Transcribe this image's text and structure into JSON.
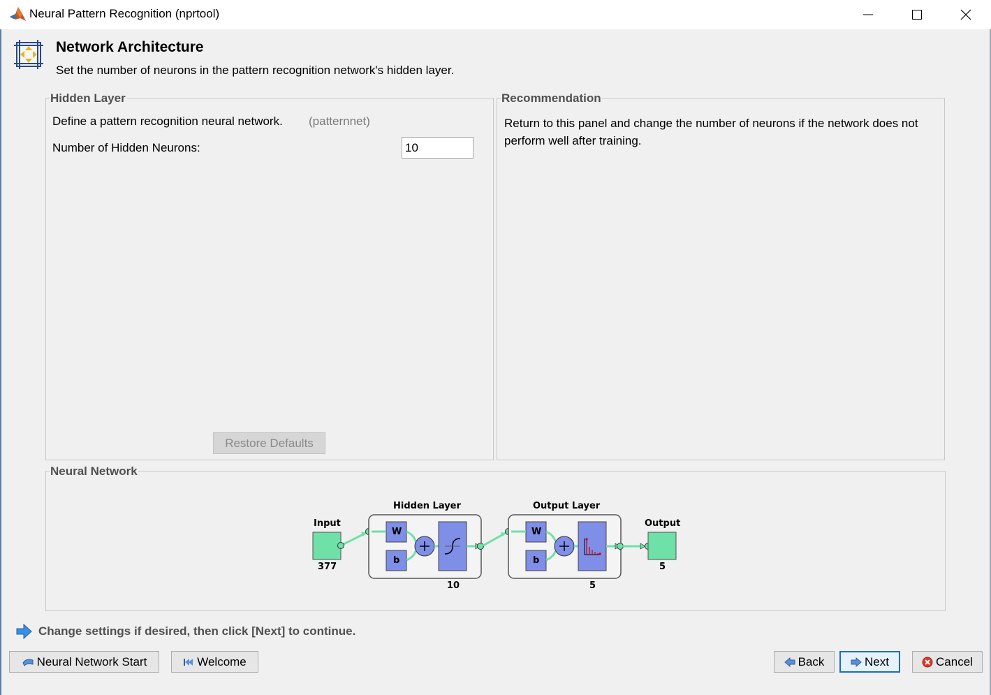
{
  "window": {
    "title": "Neural Pattern Recognition (nprtool)"
  },
  "header": {
    "title": "Network Architecture",
    "subtitle": "Set the number of neurons in the pattern recognition network's hidden layer."
  },
  "hidden_layer_panel": {
    "legend": "Hidden Layer",
    "define_text": "Define a pattern recognition neural network.",
    "function_name": "(patternnet)",
    "neurons_label": "Number of Hidden Neurons:",
    "neurons_value": "10",
    "restore_label": "Restore Defaults"
  },
  "recommendation_panel": {
    "legend": "Recommendation",
    "text": "Return to this panel and change the number of neurons if the network does not perform well after training."
  },
  "network_panel": {
    "legend": "Neural Network",
    "input_label": "Input",
    "input_size": "377",
    "hidden_label": "Hidden Layer",
    "hidden_size": "10",
    "output_layer_label": "Output Layer",
    "output_layer_size": "5",
    "output_label": "Output",
    "output_size": "5",
    "weight_symbol": "W",
    "bias_symbol": "b"
  },
  "footer": {
    "instruction": "Change settings  if desired, then click [Next] to continue.",
    "start_label": "Neural Network Start",
    "welcome_label": "Welcome",
    "back_label": "Back",
    "next_label": "Next",
    "cancel_label": "Cancel"
  },
  "colors": {
    "accent": "#1a6cc9",
    "node_green": "#6ee0a8",
    "block_blue": "#7f8ee6"
  }
}
